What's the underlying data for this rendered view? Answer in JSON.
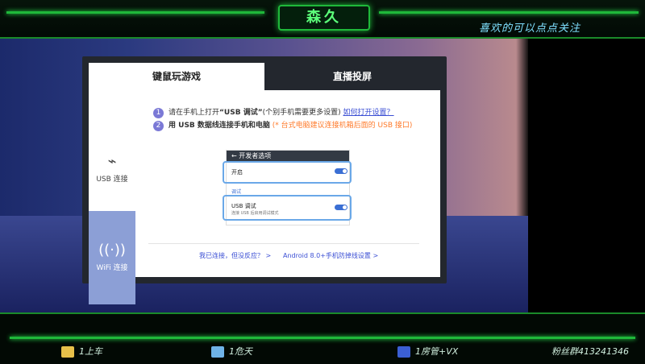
{
  "overlay": {
    "title": "森久",
    "chevron_left": "<",
    "chevron_right": ">",
    "tagline": "喜欢的可以点点关注"
  },
  "dialog": {
    "tabs": [
      "键鼠玩游戏",
      "直播投屏"
    ],
    "side": {
      "usb_label": "USB 连接",
      "wifi_label": "WiFi 连接"
    },
    "steps": {
      "step1_num": "1",
      "step1_prefix": "请在手机上打开",
      "step1_bold": "“USB 调试”",
      "step1_note": "(个别手机需要更多设置)",
      "step1_link": "如何打开设置？",
      "step2_num": "2",
      "step2_text": "用 USB 数据线连接手机和电脑",
      "step2_note": "(* 台式电脑建议连接机箱后面的 USB 接口)"
    },
    "phone": {
      "header": "← 开发者选项",
      "row1": "开启",
      "section": "调试",
      "row2_title": "USB 调试",
      "row2_sub": "连接 USB 后启用调试模式"
    },
    "links": {
      "left": "我已连接，但没反应？ >",
      "right": "Android 8.0+手机防掉线设置 >"
    }
  },
  "bottom": {
    "item1": "1上车",
    "item2": "1危天",
    "item3": "1房管+VX",
    "item4": "粉丝群413241346"
  }
}
